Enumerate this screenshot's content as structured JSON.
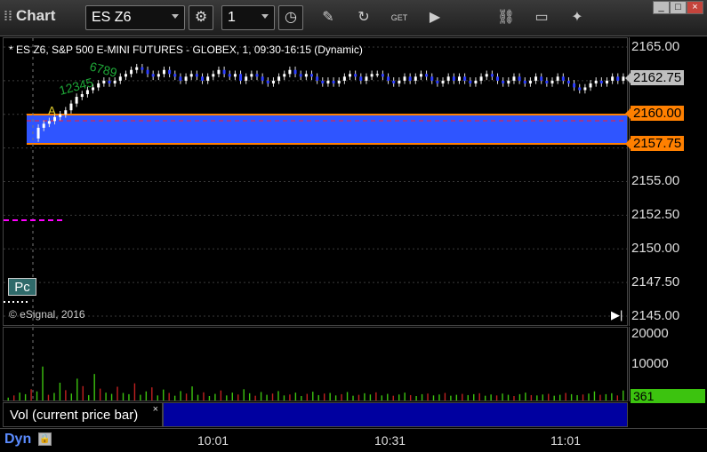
{
  "toolbar": {
    "title": "Chart",
    "symbol": "ES Z6",
    "interval": "1",
    "icons": [
      "settings-gear-icon",
      "clock-icon",
      "pencil-icon",
      "refresh-icon",
      "get-quote-icon",
      "play-icon",
      "link-icon",
      "comment-icon",
      "twitter-icon"
    ]
  },
  "window_buttons": {
    "minimize": "_",
    "maximize": "□",
    "close": "×"
  },
  "chart": {
    "header": "* ES Z6, S&P 500 E-MINI FUTURES - GLOBEX, 1, 09:30-16:15 (Dynamic)",
    "copyright": "© eSignal, 2016",
    "pc_label": "Pc",
    "marker_a": "A",
    "wave_labels": [
      "12345",
      "6789"
    ],
    "price_axis": [
      "2165.00",
      "2162.75",
      "2160.00",
      "2157.75",
      "2155.00",
      "2152.50",
      "2150.00",
      "2147.50",
      "2145.00"
    ],
    "tags": {
      "last": {
        "value": "2162.75",
        "color": "#bfbfbf"
      },
      "upper": {
        "value": "2160.00",
        "color": "#ff8000"
      },
      "lower": {
        "value": "2157.75",
        "color": "#ff8000"
      }
    },
    "band_color": "#2f55ff"
  },
  "volume": {
    "axis": [
      "20000",
      "10000"
    ],
    "last": "361",
    "legend": "Vol (current price bar)",
    "close_x": "×"
  },
  "time_axis": {
    "dyn": "Dyn",
    "labels": [
      "10:01",
      "10:31",
      "11:01"
    ]
  },
  "chart_data": {
    "type": "candlestick",
    "symbol": "ES Z6",
    "y_range": [
      2145.0,
      2165.5
    ],
    "closes": [
      2159.0,
      2159.3,
      2159.5,
      2159.8,
      2160.0,
      2160.3,
      2160.8,
      2161.3,
      2161.5,
      2161.8,
      2162.0,
      2162.3,
      2162.5,
      2162.3,
      2162.5,
      2162.8,
      2163.0,
      2163.3,
      2163.5,
      2163.3,
      2163.0,
      2162.8,
      2163.0,
      2163.3,
      2163.0,
      2162.8,
      2162.5,
      2162.8,
      2163.0,
      2162.8,
      2162.5,
      2162.8,
      2163.0,
      2163.3,
      2163.0,
      2162.8,
      2163.0,
      2162.5,
      2162.8,
      2163.0,
      2162.8,
      2162.5,
      2162.3,
      2162.5,
      2162.8,
      2163.0,
      2163.3,
      2163.0,
      2162.8,
      2163.0,
      2162.8,
      2162.5,
      2162.3,
      2162.5,
      2162.3,
      2162.5,
      2162.8,
      2163.0,
      2162.8,
      2162.5,
      2162.8,
      2163.0,
      2163.0,
      2162.8,
      2162.5,
      2162.3,
      2162.5,
      2162.8,
      2162.5,
      2162.8,
      2163.0,
      2162.8,
      2162.5,
      2162.3,
      2162.5,
      2162.8,
      2162.5,
      2162.8,
      2162.5,
      2162.3,
      2162.5,
      2162.8,
      2163.0,
      2162.8,
      2162.5,
      2162.3,
      2162.5,
      2162.8,
      2162.5,
      2162.3,
      2162.5,
      2162.8,
      2162.5,
      2162.3,
      2162.5,
      2162.8,
      2162.5,
      2162.3,
      2162.0,
      2161.8,
      2162.0,
      2162.3,
      2162.5,
      2162.3,
      2162.5,
      2162.8,
      2162.5,
      2162.8
    ],
    "volume": [
      1500,
      2200,
      3100,
      2600,
      4200,
      3500,
      11500,
      2400,
      3000,
      6300,
      3900,
      2800,
      7600,
      5200,
      2300,
      9100,
      4400,
      3100,
      2700,
      5000,
      3000,
      2600,
      6100,
      2400,
      3500,
      4800,
      2200,
      4100,
      3000,
      2100,
      3600,
      2800,
      5100,
      2400,
      3200,
      2000,
      2700,
      3800,
      2200,
      3100,
      2500,
      4200,
      2900,
      2100,
      3300,
      2400,
      2800,
      3600,
      2200,
      2500,
      3100,
      2000,
      2700,
      3400,
      2300,
      2800,
      3000,
      2200,
      2600,
      3300,
      2100,
      2400,
      2900,
      2500,
      3200,
      2200,
      2700,
      2100,
      2500,
      3100,
      2300,
      2000,
      2600,
      2800,
      2200,
      2500,
      3000,
      2100,
      2400,
      2700,
      2300,
      2600,
      2900,
      2100,
      2500,
      2200,
      2800,
      2400,
      2000,
      2600,
      3100,
      2300,
      2200,
      2500,
      2700,
      2100,
      2400,
      3000,
      2600,
      2300,
      2500,
      2800,
      3500,
      2400,
      2600,
      2900,
      2200,
      3800
    ]
  }
}
